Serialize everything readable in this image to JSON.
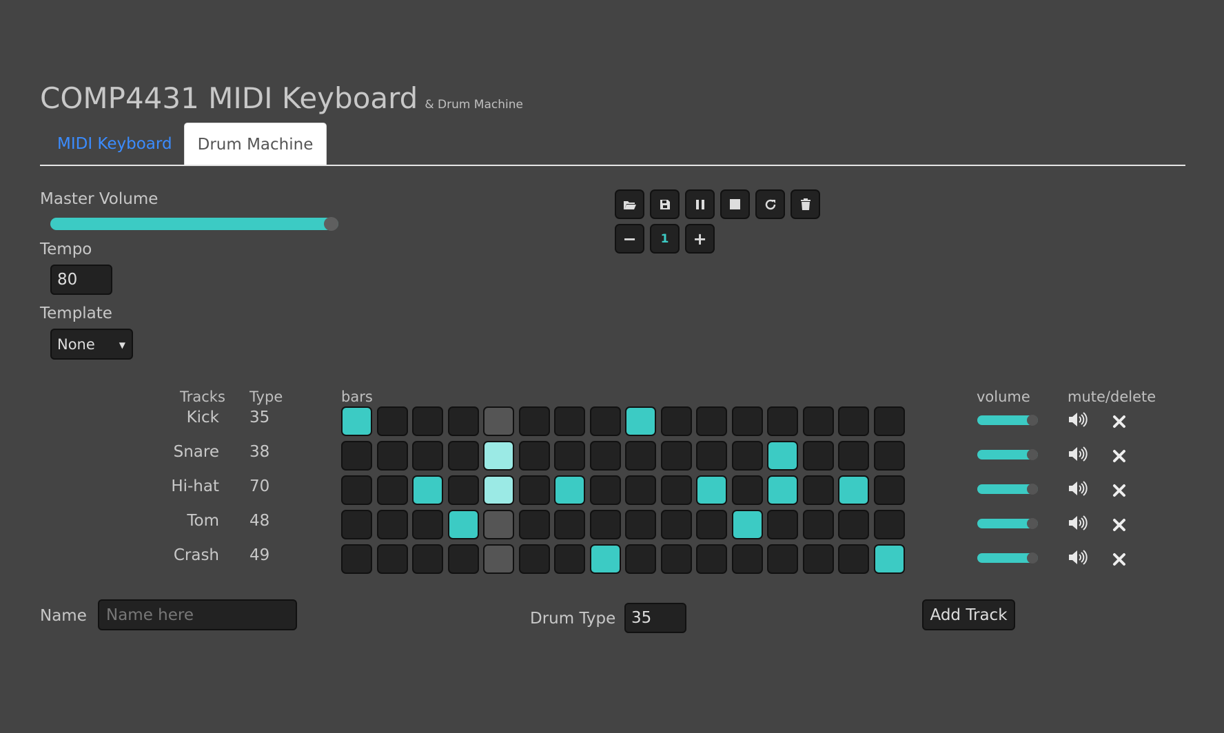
{
  "header": {
    "title": "COMP4431 MIDI Keyboard",
    "subtitle": "& Drum Machine"
  },
  "tabs": [
    {
      "label": "MIDI Keyboard",
      "active": false
    },
    {
      "label": "Drum Machine",
      "active": true
    }
  ],
  "controls": {
    "master_volume_label": "Master Volume",
    "master_volume_level": 0.94,
    "tempo_label": "Tempo",
    "tempo_value": "80",
    "template_label": "Template",
    "template_value": "None"
  },
  "toolbar": {
    "buttons": [
      "folder-open-icon",
      "save-icon",
      "pause-icon",
      "stop-icon",
      "refresh-icon",
      "trash-icon"
    ],
    "minus_label": "−",
    "count": "1",
    "plus_label": "+"
  },
  "grid": {
    "headers": {
      "tracks": "Tracks",
      "type": "Type",
      "bars": "bars",
      "volume": "volume",
      "mute_delete": "mute/delete"
    },
    "current_step": 4,
    "tracks": [
      {
        "name": "Kick",
        "type": "35",
        "steps": [
          1,
          0,
          0,
          0,
          0,
          0,
          0,
          0,
          1,
          0,
          0,
          0,
          0,
          0,
          0,
          0
        ]
      },
      {
        "name": "Snare",
        "type": "38",
        "steps": [
          0,
          0,
          0,
          0,
          1,
          0,
          0,
          0,
          0,
          0,
          0,
          0,
          1,
          0,
          0,
          0
        ]
      },
      {
        "name": "Hi-hat",
        "type": "70",
        "steps": [
          0,
          0,
          1,
          0,
          1,
          0,
          1,
          0,
          0,
          0,
          1,
          0,
          1,
          0,
          1,
          0
        ]
      },
      {
        "name": "Tom",
        "type": "48",
        "steps": [
          0,
          0,
          0,
          1,
          0,
          0,
          0,
          0,
          0,
          0,
          0,
          1,
          0,
          0,
          0,
          0
        ]
      },
      {
        "name": "Crash",
        "type": "49",
        "steps": [
          0,
          0,
          0,
          0,
          0,
          0,
          0,
          1,
          0,
          0,
          0,
          0,
          0,
          0,
          0,
          1
        ]
      }
    ]
  },
  "add_track": {
    "name_label": "Name",
    "name_placeholder": "Name here",
    "drum_type_label": "Drum Type",
    "drum_type_value": "35",
    "add_button": "Add Track"
  },
  "colors": {
    "accent": "#3ccbc4",
    "background": "#444444",
    "tab_link": "#3b8cff"
  }
}
